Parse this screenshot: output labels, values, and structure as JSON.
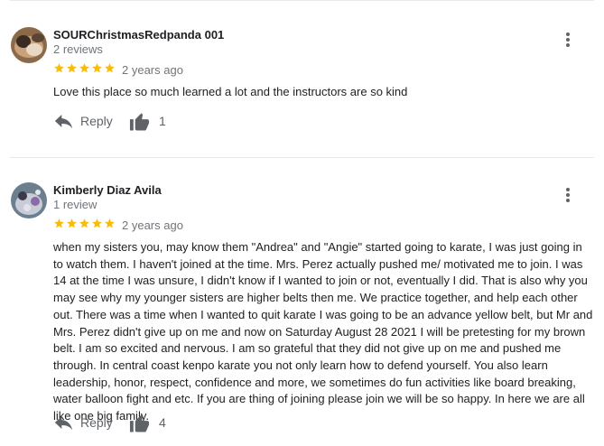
{
  "reviews": [
    {
      "author": "SOURChristmasRedpanda 001",
      "review_count": "2 reviews",
      "rating": 5,
      "date": "2 years ago",
      "text": "Love this place so much learned a lot and the instructors are so kind",
      "reply_label": "Reply",
      "likes": "1",
      "avatar_icon": "avatar-photo-icon"
    },
    {
      "author": "Kimberly Diaz Avila",
      "review_count": "1 review",
      "rating": 5,
      "date": "2 years ago",
      "text": "when my sisters you, may know them \"Andrea\" and \"Angie\"  started going to karate, I was just going in to watch them. I haven't joined at the time. Mrs. Perez actually pushed me/ motivated me to join. I was 14 at the time I was unsure, I didn't know if I wanted to join or not, eventually I did. That is also why you may see why my younger sisters are higher belts then me. We practice together, and help each other out. There was a time when I wanted to quit karate I was going to be an advance yellow belt, but Mr and Mrs. Perez didn't give up on me and now on Saturday August 28 2021 I will be pretesting for my brown belt. I am so excited and nervous. I am so grateful that they did not give up on me and pushed me through. In central coast kenpo  karate you not only learn how to defend yourself. You also learn leadership, honor, respect, confidence and more, we sometimes do fun activities like board breaking, water balloon fight and etc. If you are thing of joining please join we will be so happy. In here we are all like one big family.",
      "reply_label": "Reply",
      "likes": "4",
      "avatar_icon": "avatar-photo-icon"
    }
  ],
  "colors": {
    "star": "#fbbc04",
    "secondary_text": "#70757a",
    "action_icon": "#5f6368",
    "divider": "#e8eaed"
  }
}
